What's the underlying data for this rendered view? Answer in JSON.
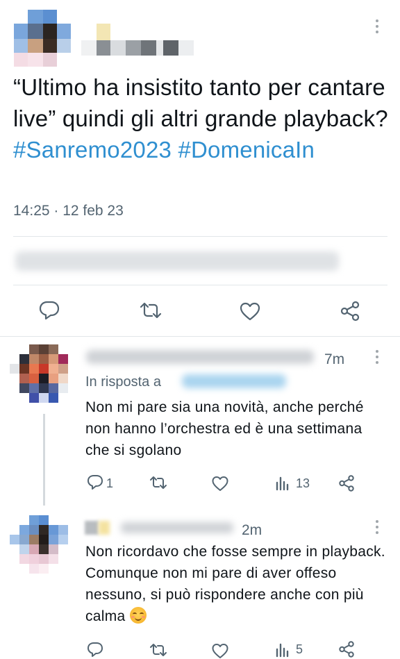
{
  "main_tweet": {
    "text": "“Ultimo ha insistito tanto per cantare live” quindi gli altri grande playback?",
    "hashtags": [
      "#Sanremo2023",
      "#DomenicaIn"
    ],
    "timestamp": "14:25 · 12 feb 23"
  },
  "replies": [
    {
      "time": "7m",
      "in_reply_to_label": "In risposta a",
      "text": "Non mi pare sia una novità, anche perché non hanno l’orchestra ed è una settimana che si sgolano",
      "reply_count": "1",
      "views": "13"
    },
    {
      "time": "2m",
      "text": "Non ricordavo che fosse sempre in playback. Comunque non mi pare di aver offeso nessuno, si può rispondere anche con più calma",
      "views": "5"
    }
  ],
  "colors": {
    "text": "#0f1419",
    "secondary": "#536471",
    "hashtag": "#2f8fd0",
    "divider": "#e2e6e9"
  },
  "icons": [
    "reply-icon",
    "retweet-icon",
    "like-icon",
    "share-icon",
    "views-icon",
    "more-icon"
  ]
}
